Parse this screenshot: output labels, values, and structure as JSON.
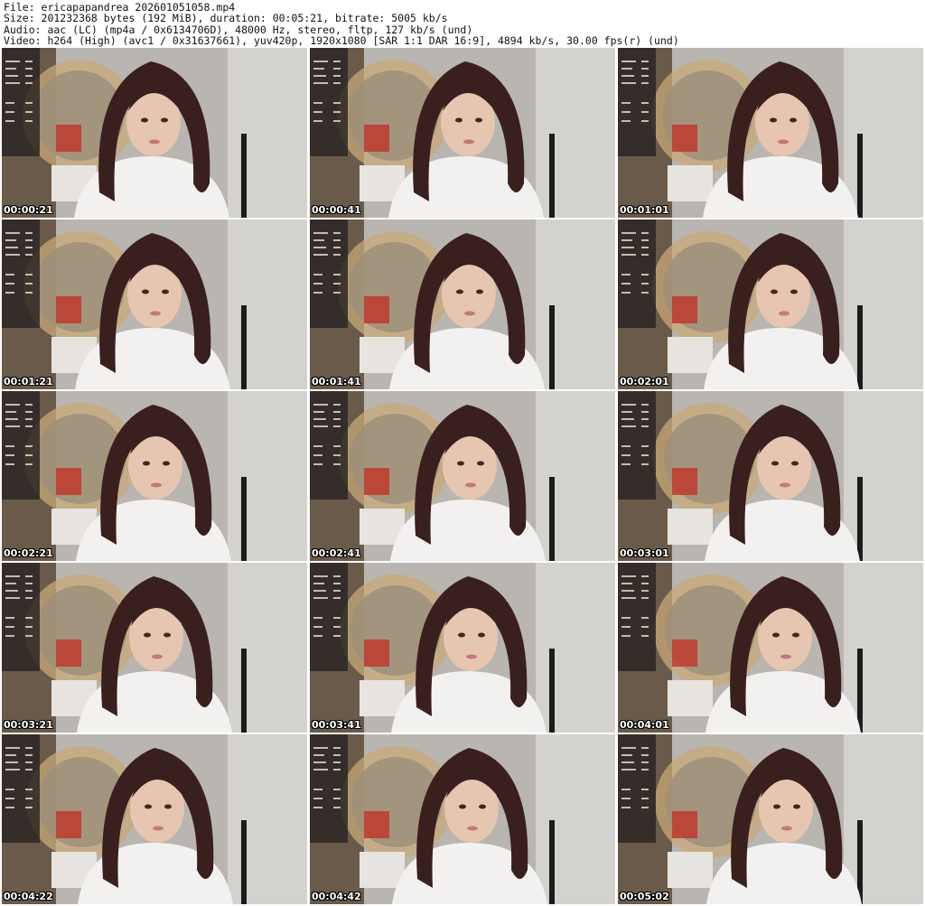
{
  "header": {
    "file_line": "File: ericapapandrea_202601051058.mp4",
    "size_line": "Size: 201232368 bytes (192 MiB), duration: 00:05:21, bitrate: 5005 kb/s",
    "audio_line": "Audio: aac (LC) (mp4a / 0x6134706D), 48000 Hz, stereo, fltp, 127 kb/s (und)",
    "video_line": "Video: h264 (High) (avc1 / 0x31637661), yuv420p, 1920x1080 [SAR 1:1 DAR 16:9], 4894 kb/s, 30.00 fps(r) (und)"
  },
  "thumbnails": [
    {
      "timestamp": "00:00:21"
    },
    {
      "timestamp": "00:00:41"
    },
    {
      "timestamp": "00:01:01"
    },
    {
      "timestamp": "00:01:21"
    },
    {
      "timestamp": "00:01:41"
    },
    {
      "timestamp": "00:02:01"
    },
    {
      "timestamp": "00:02:21"
    },
    {
      "timestamp": "00:02:41"
    },
    {
      "timestamp": "00:03:01"
    },
    {
      "timestamp": "00:03:21"
    },
    {
      "timestamp": "00:03:41"
    },
    {
      "timestamp": "00:04:01"
    },
    {
      "timestamp": "00:04:22"
    },
    {
      "timestamp": "00:04:42"
    },
    {
      "timestamp": "00:05:02"
    }
  ]
}
